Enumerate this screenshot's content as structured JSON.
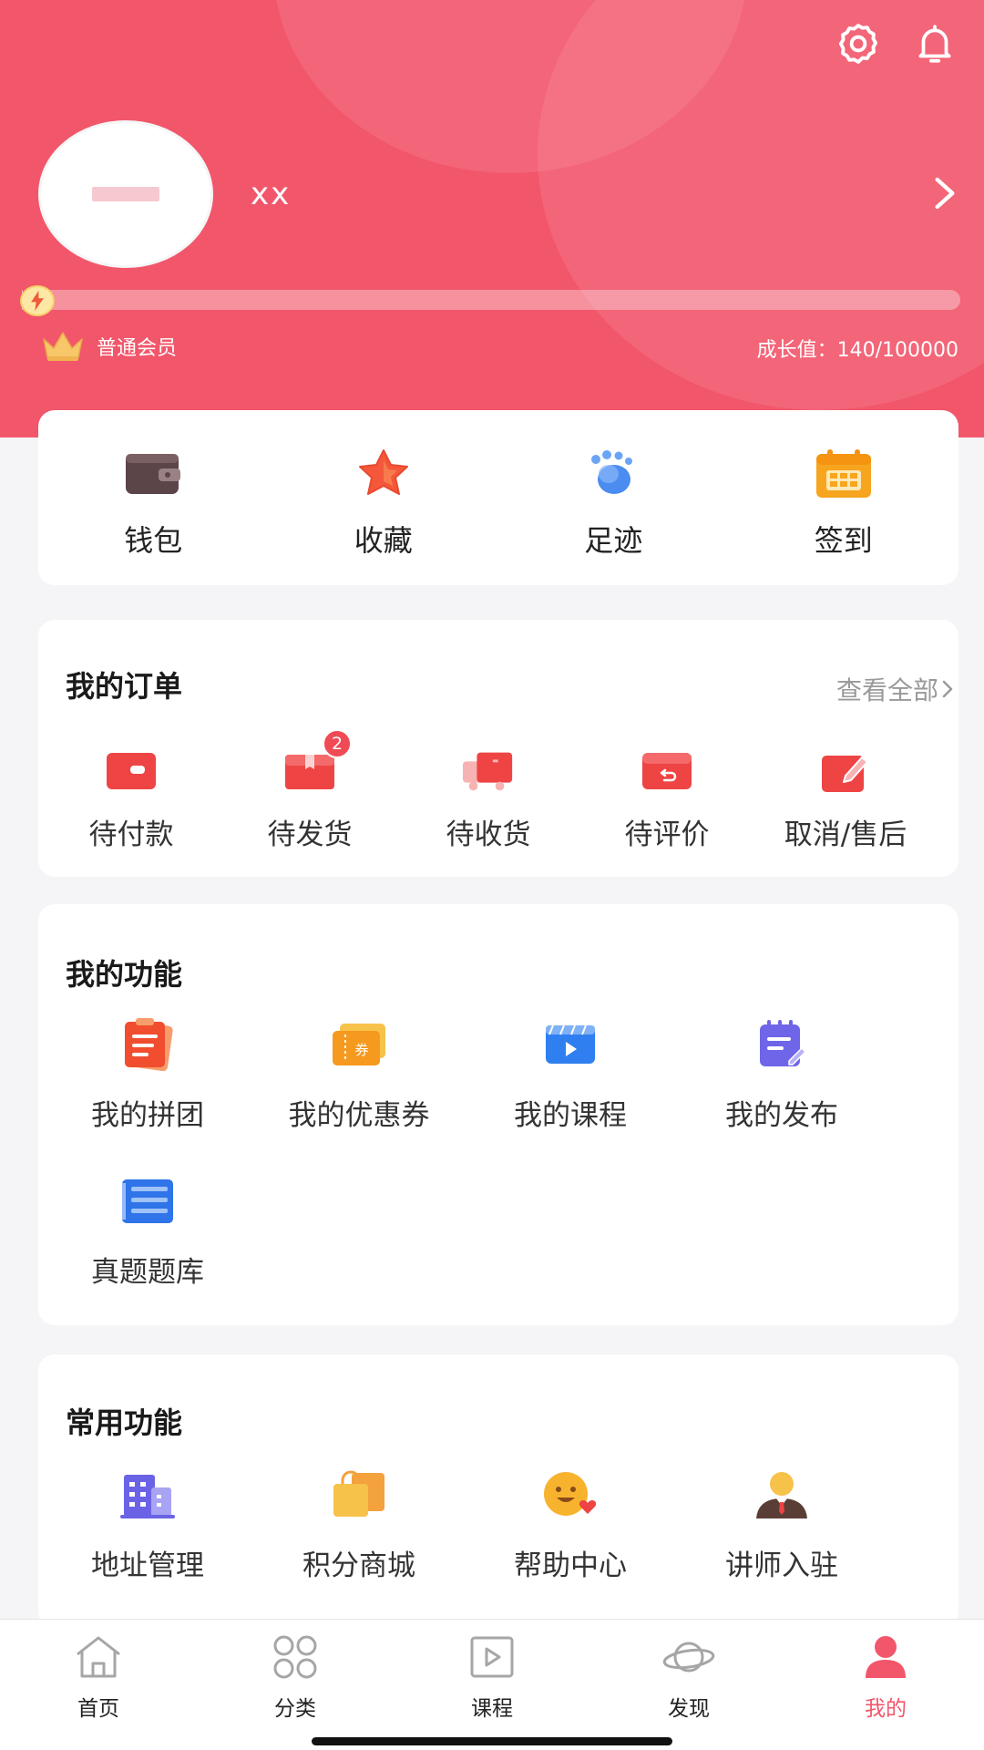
{
  "colors": {
    "brand": "#f2566b",
    "background": "#f5f5f7",
    "card": "#ffffff"
  },
  "header": {
    "username": "xx",
    "member_level": "普通会员",
    "growth_text": "成长值：140/100000",
    "growth_progress": 0.0014,
    "icons": [
      "settings-icon",
      "bell-icon",
      "chevron-right-icon",
      "lightning-icon",
      "crown-icon"
    ]
  },
  "quick_actions": [
    {
      "label": "钱包",
      "icon": "wallet-icon"
    },
    {
      "label": "收藏",
      "icon": "star-icon"
    },
    {
      "label": "足迹",
      "icon": "footprint-icon"
    },
    {
      "label": "签到",
      "icon": "calendar-icon"
    }
  ],
  "orders": {
    "title": "我的订单",
    "view_all": "查看全部",
    "items": [
      {
        "label": "待付款",
        "icon": "payment-icon"
      },
      {
        "label": "待发货",
        "icon": "package-icon",
        "badge": "2"
      },
      {
        "label": "待收货",
        "icon": "truck-icon"
      },
      {
        "label": "待评价",
        "icon": "review-box-icon"
      },
      {
        "label": "取消/售后",
        "icon": "edit-icon"
      }
    ]
  },
  "my_functions": {
    "title": "我的功能",
    "items": [
      {
        "label": "我的拼团",
        "icon": "group-buy-icon"
      },
      {
        "label": "我的优惠券",
        "icon": "coupon-icon"
      },
      {
        "label": "我的课程",
        "icon": "video-icon"
      },
      {
        "label": "我的发布",
        "icon": "publish-icon"
      },
      {
        "label": "真题题库",
        "icon": "question-bank-icon"
      }
    ]
  },
  "common_functions": {
    "title": "常用功能",
    "items": [
      {
        "label": "地址管理",
        "icon": "building-icon"
      },
      {
        "label": "积分商城",
        "icon": "shopping-bag-icon"
      },
      {
        "label": "帮助中心",
        "icon": "smile-heart-icon"
      },
      {
        "label": "讲师入驻",
        "icon": "lecturer-icon"
      }
    ]
  },
  "tabbar": [
    {
      "label": "首页",
      "icon": "home-icon"
    },
    {
      "label": "分类",
      "icon": "category-icon"
    },
    {
      "label": "课程",
      "icon": "course-play-icon"
    },
    {
      "label": "发现",
      "icon": "planet-icon"
    },
    {
      "label": "我的",
      "icon": "profile-icon",
      "active": true
    }
  ]
}
